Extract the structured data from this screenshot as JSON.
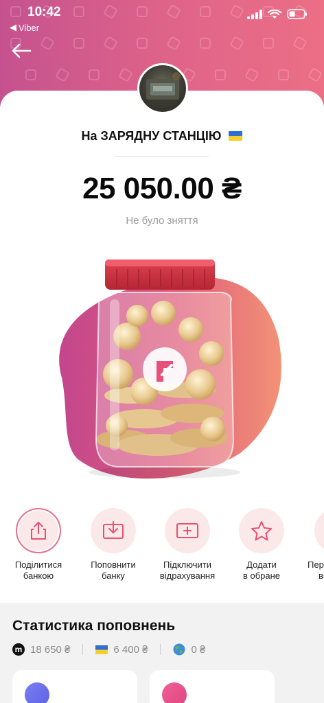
{
  "status_bar": {
    "time": "10:42",
    "back_app": "Viber",
    "icons": [
      "signal-icon",
      "wifi-icon",
      "battery-icon"
    ]
  },
  "nav": {
    "back_icon": "arrow-left-icon"
  },
  "jar": {
    "title": "На ЗАРЯДНУ СТАНЦІЮ",
    "title_flag": "ukraine-flag-icon",
    "amount": "25 050.00 ₴",
    "status": "Не було зняття"
  },
  "actions": [
    {
      "label_line1": "Поділитися",
      "label_line2": "банкою",
      "icon": "share-icon"
    },
    {
      "label_line1": "Поповнити",
      "label_line2": "банку",
      "icon": "top-up-icon"
    },
    {
      "label_line1": "Підключити",
      "label_line2": "відрахування",
      "icon": "add-deduction-icon"
    },
    {
      "label_line1": "Додати",
      "label_line2": "в обране",
      "icon": "star-icon"
    },
    {
      "label_line1": "Пер",
      "label_line2": "ви",
      "icon": "more-icon"
    }
  ],
  "stats": {
    "title": "Статистика поповнень",
    "items": [
      {
        "icon": "monobank-logo-icon",
        "value": "18 650 ₴"
      },
      {
        "icon": "ukraine-flag-icon",
        "value": "6 400 ₴"
      },
      {
        "icon": "globe-icon",
        "value": "0 ₴"
      }
    ]
  },
  "colors": {
    "header_start": "#c5528f",
    "header_end": "#ec6f86",
    "accent_pink": "#e8708b",
    "action_bg": "#fbe9ea"
  }
}
